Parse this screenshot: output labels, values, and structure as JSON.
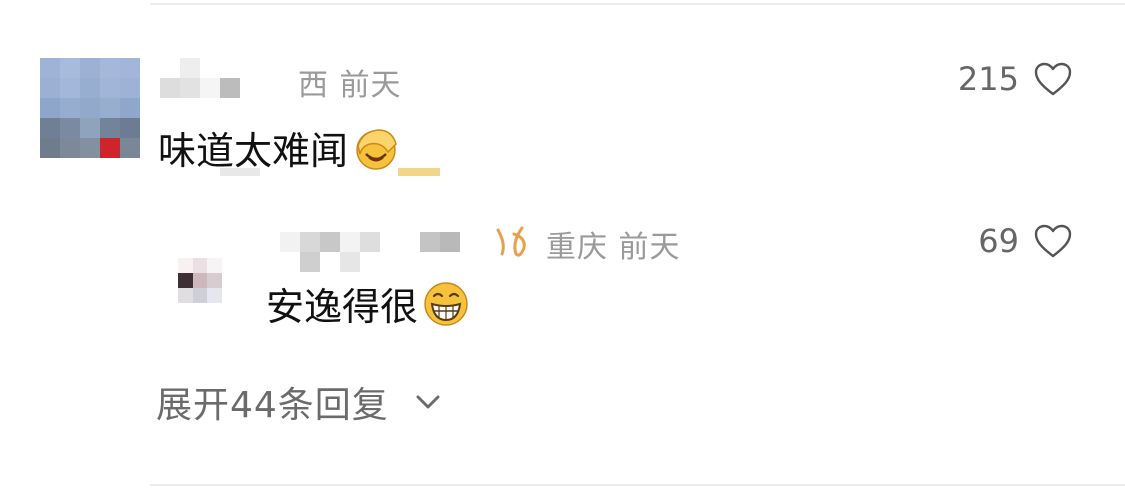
{
  "comment": {
    "location": "西",
    "time": "前天",
    "text": "味道太难闻",
    "emoji": "facepalm-emoji",
    "likes": "215",
    "avatar_colors": [
      "#9fb3d6",
      "#a7bbdc",
      "#9cb1d3",
      "#a5b8d9",
      "#a1b6d8",
      "#9bb0d2",
      "#a3b7da",
      "#98aed1",
      "#a0b5d8",
      "#9db2d4",
      "#8ea6c9",
      "#96add0",
      "#93a9cc",
      "#97aecf",
      "#8fa7ca",
      "#6e7f96",
      "#7a8aa1",
      "#8fa3bd",
      "#73839a",
      "#6c7c92",
      "#6f7c8c",
      "#7d8898",
      "#83909f",
      "#d0242c",
      "#7a8796"
    ],
    "name_colors": [
      "#ffffff",
      "#eeeeee",
      "#ffffff",
      "#ffffff",
      "#ffffff",
      "#ffffff",
      "#dddddd",
      "#e2e2e2",
      "#f5f5f5",
      "#bcbcbc",
      "#ffffff",
      "#ffffff"
    ]
  },
  "reply": {
    "location": "重庆",
    "time": "前天",
    "text": "安逸得很",
    "emoji": "grinning-emoji",
    "likes": "69",
    "avatar_colors": [
      "#f7f1f2",
      "#eadfe2",
      "#f6f4f4",
      "#3d2f33",
      "#cfb8bd",
      "#d7cdd0",
      "#e0dee1",
      "#cfcfd8",
      "#e6e6ee",
      "#ffffff",
      "#ffffff",
      "#ffffff"
    ],
    "name_colors": [
      "#f2f2f2",
      "#d8d8d8",
      "#c8c8c8",
      "#f3f3f3",
      "#dedede",
      "#ffffff",
      "#ffffff",
      "#c4c4c4",
      "#b9b9b9",
      "#ffffff",
      "#cfcfcf",
      "#ffffff",
      "#e6e6e6",
      "#ffffff",
      "#ffffff",
      "#ffffff",
      "#ffffff",
      "#ffffff"
    ]
  },
  "expand_label": "展开44条回复",
  "colors": {
    "meta": "#9a9a9a",
    "badge": "#e8a04a",
    "emoji_yellow": "#f7c23b"
  }
}
